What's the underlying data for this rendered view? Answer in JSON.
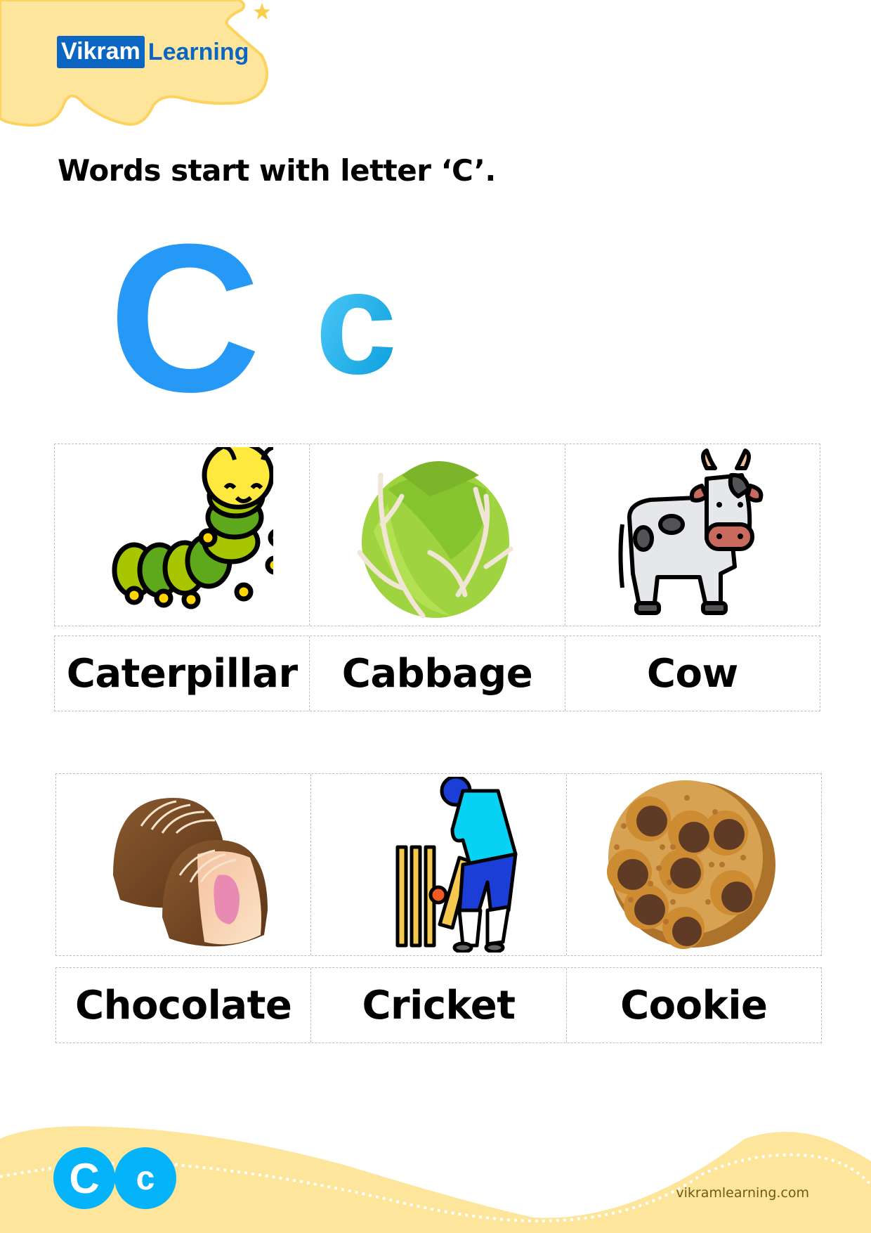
{
  "brand": {
    "part1": "Vikram",
    "part2": "Learning",
    "color": "#0b66c3"
  },
  "title": "Words start with letter ‘C’.",
  "letters": {
    "upper": "C",
    "lower": "c",
    "upper_color": "#2699f6",
    "lower_color": "#2db5ec"
  },
  "rows": [
    {
      "items": [
        {
          "word": "Caterpillar",
          "icon": "caterpillar-icon"
        },
        {
          "word": "Cabbage",
          "icon": "cabbage-icon"
        },
        {
          "word": "Cow",
          "icon": "cow-icon"
        }
      ]
    },
    {
      "items": [
        {
          "word": "Chocolate",
          "icon": "chocolate-icon"
        },
        {
          "word": "Cricket",
          "icon": "cricket-icon"
        },
        {
          "word": "Cookie",
          "icon": "cookie-icon"
        }
      ]
    }
  ],
  "footer": {
    "badge_upper": "C",
    "badge_lower": "c",
    "website": "vikramlearning.com",
    "badge_color": "#05b3fb",
    "band_color": "#fde69b"
  }
}
